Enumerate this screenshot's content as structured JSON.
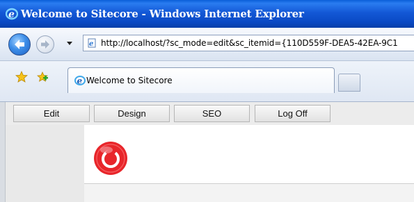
{
  "window": {
    "title": "Welcome to Sitecore - Windows Internet Explorer"
  },
  "address_bar": {
    "url": "http://localhost/?sc_mode=edit&sc_itemid={110D559F-DEA5-42EA-9C1"
  },
  "tabs": [
    {
      "label": "Welcome to Sitecore",
      "active": true
    }
  ],
  "sitecore_toolbar": {
    "buttons": [
      {
        "label": "Edit"
      },
      {
        "label": "Design"
      },
      {
        "label": "SEO"
      },
      {
        "label": "Log Off"
      }
    ]
  },
  "icons": {
    "title": "ie-logo-icon",
    "back": "back-arrow-icon",
    "forward": "forward-arrow-icon",
    "favorites": "favorites-star-icon",
    "add_favorites": "add-favorites-icon",
    "tab": "ie-logo-icon",
    "logo": "sitecore-logo-icon"
  },
  "colors": {
    "title_bar": "#1358d6",
    "toolbar": "#ececec",
    "logo_red": "#e8262b"
  }
}
